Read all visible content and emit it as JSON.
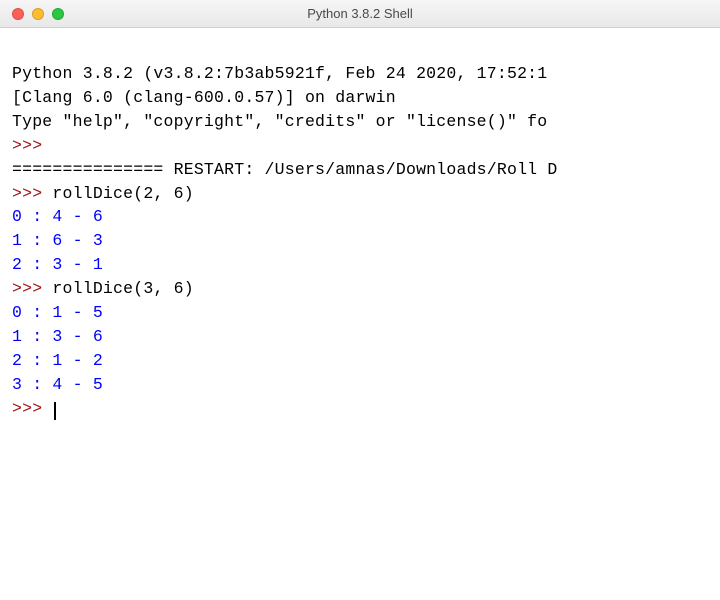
{
  "window": {
    "title": "Python 3.8.2 Shell"
  },
  "banner": {
    "line1": "Python 3.8.2 (v3.8.2:7b3ab5921f, Feb 24 2020, 17:52:1",
    "line2": "[Clang 6.0 (clang-600.0.57)] on darwin",
    "line3": "Type \"help\", \"copyright\", \"credits\" or \"license()\" fo"
  },
  "prompt_str": ">>>",
  "restart_line": "=============== RESTART: /Users/amnas/Downloads/Roll D",
  "calls": [
    {
      "input": "rollDice(2, 6)",
      "output": [
        "0 : 4 - 6",
        "1 : 6 - 3",
        "2 : 3 - 1"
      ]
    },
    {
      "input": "rollDice(3, 6)",
      "output": [
        "0 : 1 - 5",
        "1 : 3 - 6",
        "2 : 1 - 2",
        "3 : 4 - 5"
      ]
    }
  ]
}
